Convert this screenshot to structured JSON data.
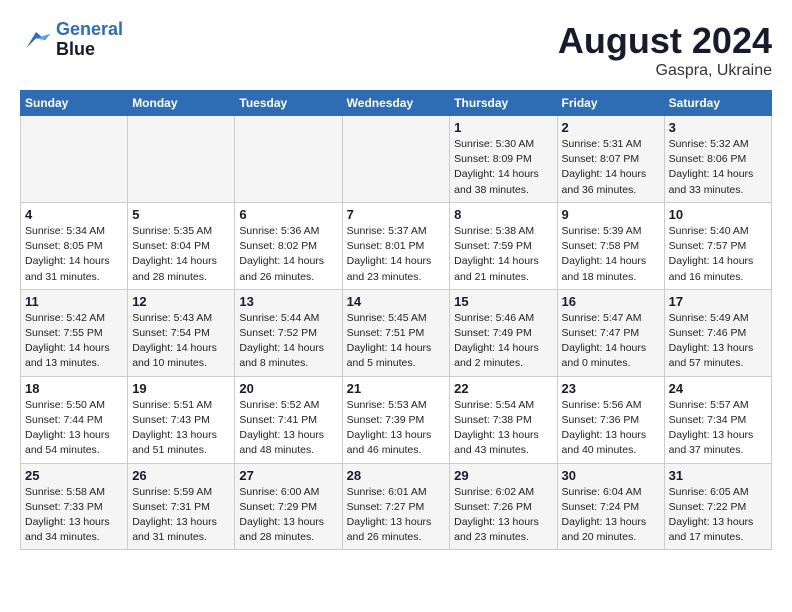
{
  "header": {
    "logo_line1": "General",
    "logo_line2": "Blue",
    "month_year": "August 2024",
    "location": "Gaspra, Ukraine"
  },
  "weekdays": [
    "Sunday",
    "Monday",
    "Tuesday",
    "Wednesday",
    "Thursday",
    "Friday",
    "Saturday"
  ],
  "weeks": [
    [
      {
        "day": "",
        "info": ""
      },
      {
        "day": "",
        "info": ""
      },
      {
        "day": "",
        "info": ""
      },
      {
        "day": "",
        "info": ""
      },
      {
        "day": "1",
        "info": "Sunrise: 5:30 AM\nSunset: 8:09 PM\nDaylight: 14 hours\nand 38 minutes."
      },
      {
        "day": "2",
        "info": "Sunrise: 5:31 AM\nSunset: 8:07 PM\nDaylight: 14 hours\nand 36 minutes."
      },
      {
        "day": "3",
        "info": "Sunrise: 5:32 AM\nSunset: 8:06 PM\nDaylight: 14 hours\nand 33 minutes."
      }
    ],
    [
      {
        "day": "4",
        "info": "Sunrise: 5:34 AM\nSunset: 8:05 PM\nDaylight: 14 hours\nand 31 minutes."
      },
      {
        "day": "5",
        "info": "Sunrise: 5:35 AM\nSunset: 8:04 PM\nDaylight: 14 hours\nand 28 minutes."
      },
      {
        "day": "6",
        "info": "Sunrise: 5:36 AM\nSunset: 8:02 PM\nDaylight: 14 hours\nand 26 minutes."
      },
      {
        "day": "7",
        "info": "Sunrise: 5:37 AM\nSunset: 8:01 PM\nDaylight: 14 hours\nand 23 minutes."
      },
      {
        "day": "8",
        "info": "Sunrise: 5:38 AM\nSunset: 7:59 PM\nDaylight: 14 hours\nand 21 minutes."
      },
      {
        "day": "9",
        "info": "Sunrise: 5:39 AM\nSunset: 7:58 PM\nDaylight: 14 hours\nand 18 minutes."
      },
      {
        "day": "10",
        "info": "Sunrise: 5:40 AM\nSunset: 7:57 PM\nDaylight: 14 hours\nand 16 minutes."
      }
    ],
    [
      {
        "day": "11",
        "info": "Sunrise: 5:42 AM\nSunset: 7:55 PM\nDaylight: 14 hours\nand 13 minutes."
      },
      {
        "day": "12",
        "info": "Sunrise: 5:43 AM\nSunset: 7:54 PM\nDaylight: 14 hours\nand 10 minutes."
      },
      {
        "day": "13",
        "info": "Sunrise: 5:44 AM\nSunset: 7:52 PM\nDaylight: 14 hours\nand 8 minutes."
      },
      {
        "day": "14",
        "info": "Sunrise: 5:45 AM\nSunset: 7:51 PM\nDaylight: 14 hours\nand 5 minutes."
      },
      {
        "day": "15",
        "info": "Sunrise: 5:46 AM\nSunset: 7:49 PM\nDaylight: 14 hours\nand 2 minutes."
      },
      {
        "day": "16",
        "info": "Sunrise: 5:47 AM\nSunset: 7:47 PM\nDaylight: 14 hours\nand 0 minutes."
      },
      {
        "day": "17",
        "info": "Sunrise: 5:49 AM\nSunset: 7:46 PM\nDaylight: 13 hours\nand 57 minutes."
      }
    ],
    [
      {
        "day": "18",
        "info": "Sunrise: 5:50 AM\nSunset: 7:44 PM\nDaylight: 13 hours\nand 54 minutes."
      },
      {
        "day": "19",
        "info": "Sunrise: 5:51 AM\nSunset: 7:43 PM\nDaylight: 13 hours\nand 51 minutes."
      },
      {
        "day": "20",
        "info": "Sunrise: 5:52 AM\nSunset: 7:41 PM\nDaylight: 13 hours\nand 48 minutes."
      },
      {
        "day": "21",
        "info": "Sunrise: 5:53 AM\nSunset: 7:39 PM\nDaylight: 13 hours\nand 46 minutes."
      },
      {
        "day": "22",
        "info": "Sunrise: 5:54 AM\nSunset: 7:38 PM\nDaylight: 13 hours\nand 43 minutes."
      },
      {
        "day": "23",
        "info": "Sunrise: 5:56 AM\nSunset: 7:36 PM\nDaylight: 13 hours\nand 40 minutes."
      },
      {
        "day": "24",
        "info": "Sunrise: 5:57 AM\nSunset: 7:34 PM\nDaylight: 13 hours\nand 37 minutes."
      }
    ],
    [
      {
        "day": "25",
        "info": "Sunrise: 5:58 AM\nSunset: 7:33 PM\nDaylight: 13 hours\nand 34 minutes."
      },
      {
        "day": "26",
        "info": "Sunrise: 5:59 AM\nSunset: 7:31 PM\nDaylight: 13 hours\nand 31 minutes."
      },
      {
        "day": "27",
        "info": "Sunrise: 6:00 AM\nSunset: 7:29 PM\nDaylight: 13 hours\nand 28 minutes."
      },
      {
        "day": "28",
        "info": "Sunrise: 6:01 AM\nSunset: 7:27 PM\nDaylight: 13 hours\nand 26 minutes."
      },
      {
        "day": "29",
        "info": "Sunrise: 6:02 AM\nSunset: 7:26 PM\nDaylight: 13 hours\nand 23 minutes."
      },
      {
        "day": "30",
        "info": "Sunrise: 6:04 AM\nSunset: 7:24 PM\nDaylight: 13 hours\nand 20 minutes."
      },
      {
        "day": "31",
        "info": "Sunrise: 6:05 AM\nSunset: 7:22 PM\nDaylight: 13 hours\nand 17 minutes."
      }
    ]
  ]
}
